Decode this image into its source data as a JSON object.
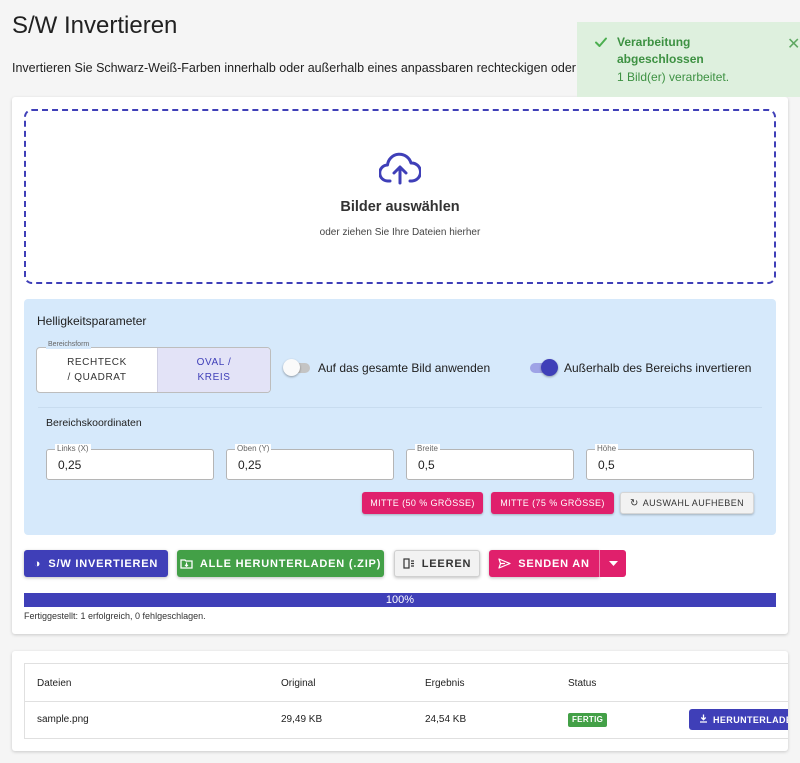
{
  "page": {
    "title": "S/W Invertieren",
    "description": "Invertieren Sie Schwarz-Weiß-Farben innerhalb oder außerhalb eines anpassbaren rechteckigen oder"
  },
  "dropzone": {
    "title": "Bilder auswählen",
    "subtitle": "oder ziehen Sie Ihre Dateien hierher",
    "icon": "cloud-upload-icon"
  },
  "params": {
    "title": "Helligkeitsparameter",
    "shape_legend": "Bereichsform",
    "shape_options": [
      {
        "label": "RECHTECK / QUADRAT",
        "selected": false
      },
      {
        "label": "OVAL / KREIS",
        "selected": true
      }
    ],
    "toggle_whole_image": {
      "label": "Auf das gesamte Bild anwenden",
      "on": false
    },
    "toggle_invert_outside": {
      "label": "Außerhalb des Bereichs invertieren",
      "on": true
    },
    "coords": {
      "title": "Bereichskoordinaten",
      "fields": [
        {
          "label": "Links (X)",
          "value": "0,25"
        },
        {
          "label": "Oben (Y)",
          "value": "0,25"
        },
        {
          "label": "Breite",
          "value": "0,5"
        },
        {
          "label": "Höhe",
          "value": "0,5"
        }
      ],
      "btn_center50": "MITTE (50 % GRÖSSE)",
      "btn_center75": "MITTE (75 % GRÖSSE)",
      "btn_clear": "AUSWAHL AUFHEBEN"
    }
  },
  "actions": {
    "invert": "S/W INVERTIEREN",
    "download_all": "ALLE HERUNTERLADEN (.ZIP)",
    "clear": "LEEREN",
    "send": "SENDEN AN"
  },
  "progress": {
    "percent": 100,
    "label": "100%",
    "summary": "Fertiggestellt: 1 erfolgreich, 0 fehlgeschlagen."
  },
  "table": {
    "headers": [
      "Dateien",
      "Original",
      "Ergebnis",
      "Status"
    ],
    "rows": [
      {
        "file": "sample.png",
        "original": "29,49 KB",
        "result": "24,54 KB",
        "status": "FERTIG",
        "action": "HERUNTERLADEN"
      }
    ]
  },
  "toast": {
    "title": "Verarbeitung abgeschlossen",
    "message": "1 Bild(er) verarbeitet."
  },
  "colors": {
    "primary": "#3f3fb8",
    "pink": "#e0206c",
    "green": "#43a047",
    "panel": "#d6e9fb",
    "toast_bg": "#def0de"
  }
}
